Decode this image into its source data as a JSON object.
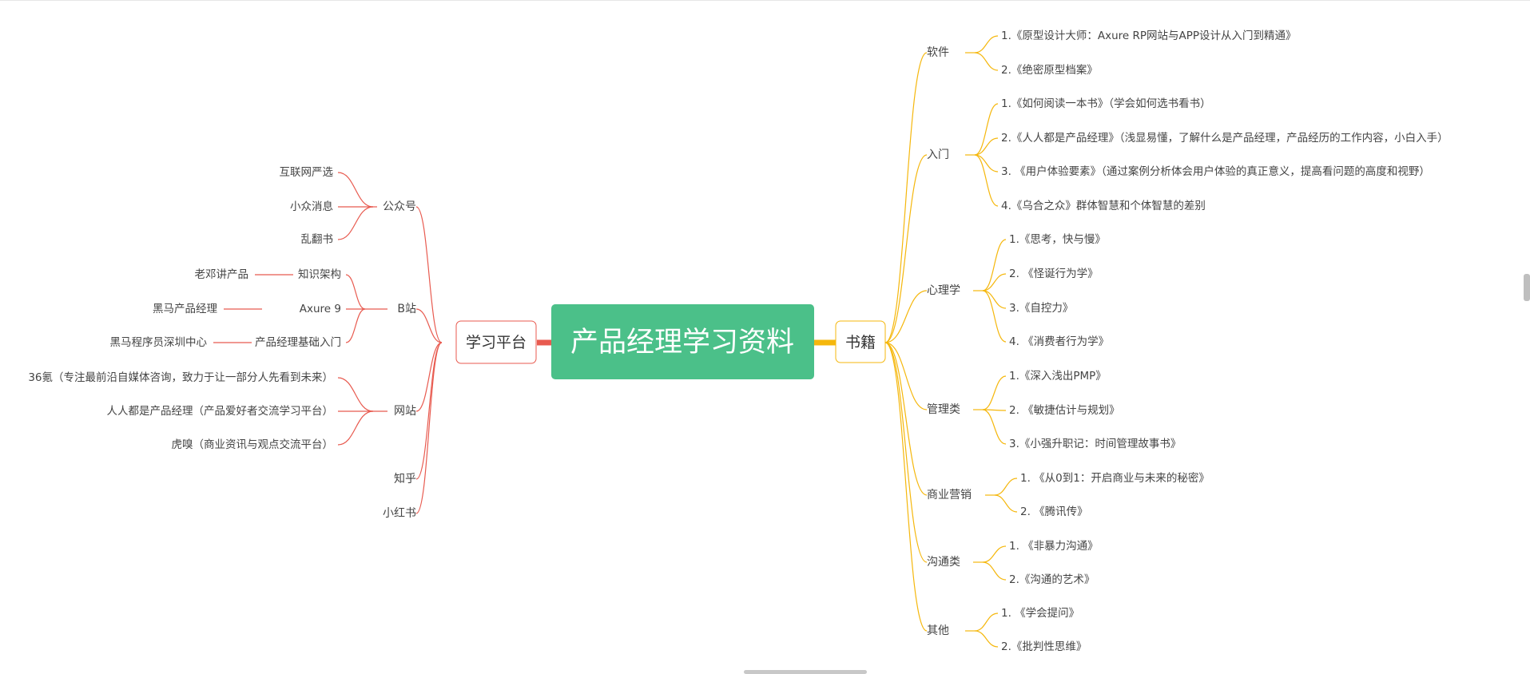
{
  "root": {
    "label": "产品经理学习资料",
    "fill": "#4bc089",
    "text_color": "#ffffff"
  },
  "left": {
    "label": "学习平台",
    "color": "#e85a4f",
    "children": [
      {
        "label": "公众号",
        "children": [
          {
            "label": "互联网严选"
          },
          {
            "label": "小众消息"
          },
          {
            "label": "乱翻书"
          }
        ]
      },
      {
        "label": "B站",
        "children": [
          {
            "label": "知识架构",
            "children": [
              {
                "label": "老邓讲产品"
              }
            ]
          },
          {
            "label": "Axure 9",
            "children": [
              {
                "label": "黑马产品经理"
              }
            ]
          },
          {
            "label": "产品经理基础入门",
            "children": [
              {
                "label": "黑马程序员深圳中心"
              }
            ]
          }
        ]
      },
      {
        "label": "网站",
        "children": [
          {
            "label": "36氪（专注最前沿自媒体咨询，致力于让一部分人先看到未来）"
          },
          {
            "label": "人人都是产品经理（产品爱好者交流学习平台）"
          },
          {
            "label": "虎嗅（商业资讯与观点交流平台）"
          }
        ]
      },
      {
        "label": "知乎"
      },
      {
        "label": "小红书"
      }
    ]
  },
  "right": {
    "label": "书籍",
    "color": "#f5b70c",
    "children": [
      {
        "label": "软件",
        "children": [
          {
            "label": "1.《原型设计大师：Axure RP网站与APP设计从入门到精通》"
          },
          {
            "label": "2.《绝密原型档案》"
          }
        ]
      },
      {
        "label": "入门",
        "children": [
          {
            "label": "1.《如何阅读一本书》（学会如何选书看书）"
          },
          {
            "label": "2.《人人都是产品经理》（浅显易懂，了解什么是产品经理，产品经历的工作内容，小白入手）"
          },
          {
            "label": "3. 《用户体验要素》（通过案例分析体会用户体验的真正意义，提高看问题的高度和视野）"
          },
          {
            "label": "4.《乌合之众》群体智慧和个体智慧的差别"
          }
        ]
      },
      {
        "label": "心理学",
        "children": [
          {
            "label": "1.《思考，快与慢》"
          },
          {
            "label": "2. 《怪诞行为学》"
          },
          {
            "label": "3.《自控力》"
          },
          {
            "label": "4. 《消费者行为学》"
          }
        ]
      },
      {
        "label": "管理类",
        "children": [
          {
            "label": "1.《深入浅出PMP》"
          },
          {
            "label": "2. 《敏捷估计与规划》"
          },
          {
            "label": "3.《小强升职记：时间管理故事书》"
          }
        ]
      },
      {
        "label": "商业营销",
        "children": [
          {
            "label": "1. 《从0到1：开启商业与未来的秘密》"
          },
          {
            "label": "2. 《腾讯传》"
          }
        ]
      },
      {
        "label": "沟通类",
        "children": [
          {
            "label": "1. 《非暴力沟通》"
          },
          {
            "label": "2.《沟通的艺术》"
          }
        ]
      },
      {
        "label": "其他",
        "children": [
          {
            "label": "1. 《学会提问》"
          },
          {
            "label": "2.《批判性思维》"
          }
        ]
      }
    ]
  }
}
